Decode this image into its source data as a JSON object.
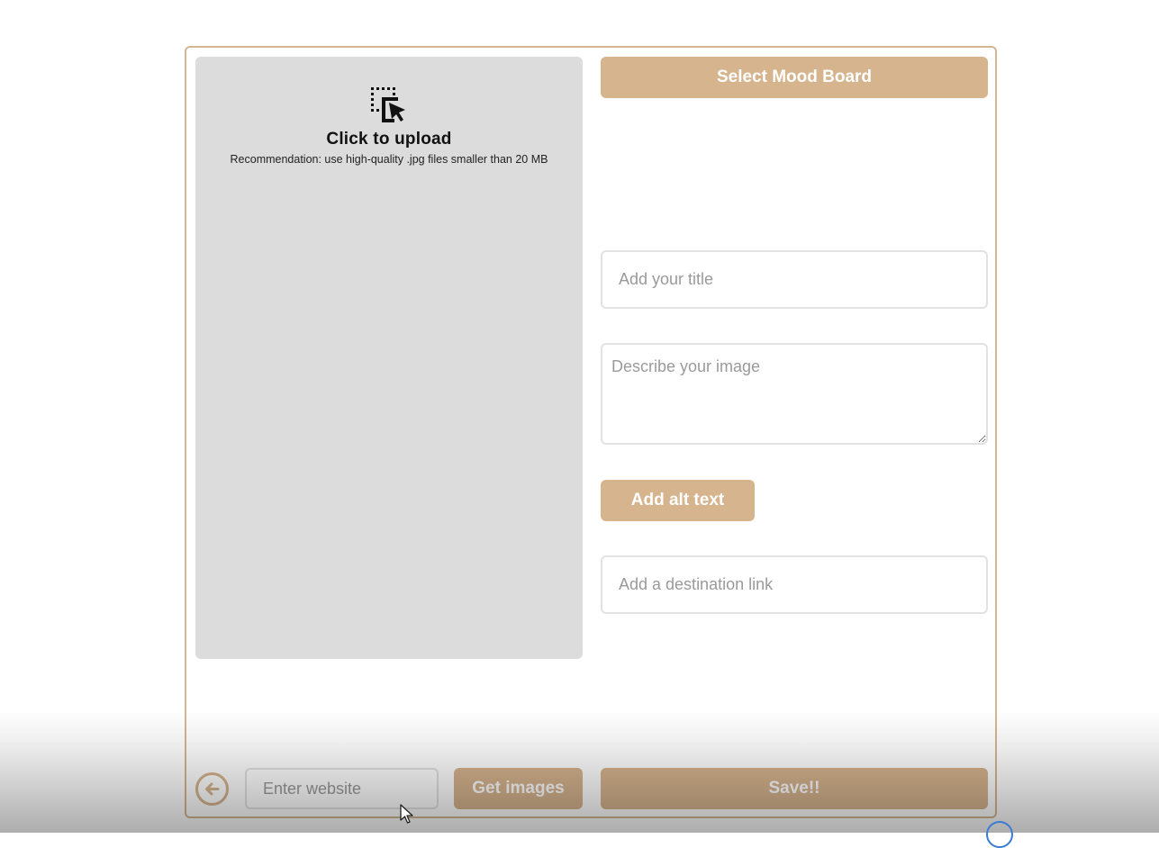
{
  "upload": {
    "icon": "click-select-upload-icon",
    "title": "Click to upload",
    "hint": "Recommendation: use high-quality .jpg files smaller than 20 MB"
  },
  "form": {
    "select_board_label": "Select Mood Board",
    "title_placeholder": "Add your title",
    "description_placeholder": "Describe your image",
    "alt_text_label": "Add alt text",
    "link_placeholder": "Add a destination link"
  },
  "footer": {
    "back_icon": "back-arrow-icon",
    "website_placeholder": "Enter website",
    "get_images_label": "Get images",
    "save_label": "Save!!"
  },
  "colors": {
    "accent": "#d6b48e",
    "border": "#d4b693",
    "upload_bg": "#dcdcdc"
  }
}
